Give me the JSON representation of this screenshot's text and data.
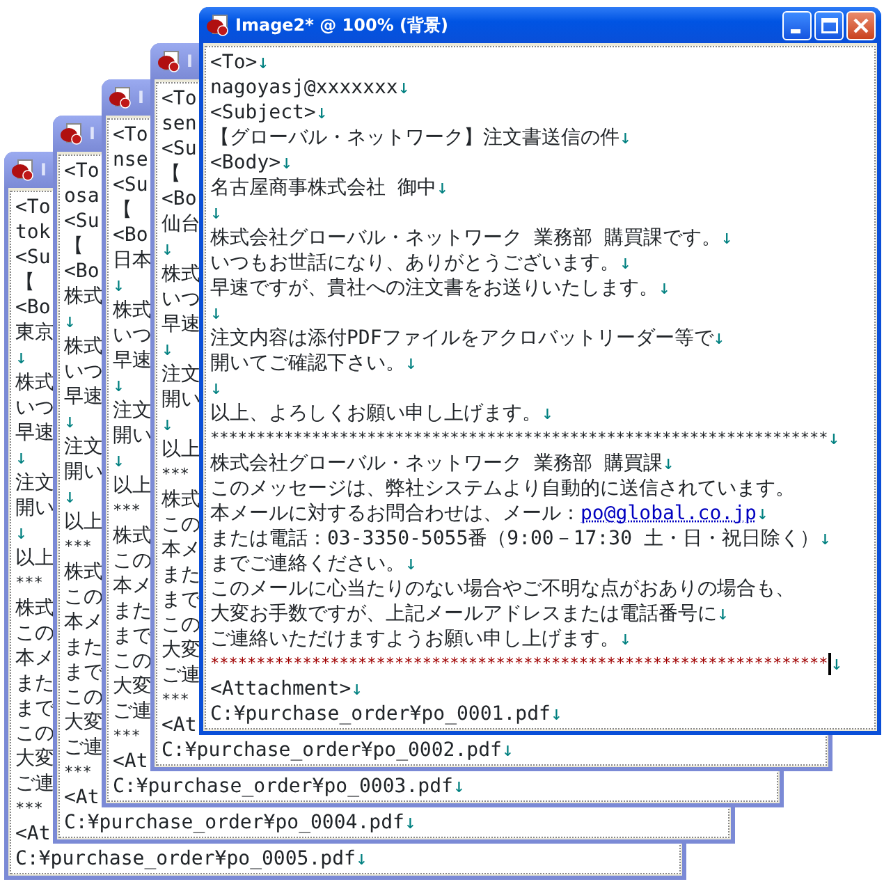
{
  "windows": [
    {
      "title": "I",
      "active": false,
      "lines": [
        {
          "text": "<To"
        },
        {
          "text": "tok"
        },
        {
          "text": "<Su"
        },
        {
          "text": "【"
        },
        {
          "text": "<Bo"
        },
        {
          "text": "東京"
        },
        {
          "eol": "↓"
        },
        {
          "text": "株式"
        },
        {
          "text": "いつ"
        },
        {
          "text": "早速"
        },
        {
          "eol": "↓"
        },
        {
          "text": "注文"
        },
        {
          "text": "開い"
        },
        {
          "eol": "↓"
        },
        {
          "text": "以上"
        },
        {
          "text": "***",
          "kind": "rule"
        },
        {
          "text": "株式"
        },
        {
          "text": "この"
        },
        {
          "text": "本メ"
        },
        {
          "text": "また"
        },
        {
          "text": "まで"
        },
        {
          "text": "この"
        },
        {
          "text": "大変"
        },
        {
          "text": "ご連"
        },
        {
          "text": "***",
          "kind": "rule"
        },
        {
          "text": "<At"
        },
        {
          "text": "C:¥purchase_order¥po_0005.pdf",
          "eol": "↓"
        }
      ]
    },
    {
      "title": "I",
      "active": false,
      "lines": [
        {
          "text": "<To"
        },
        {
          "text": "osa"
        },
        {
          "text": "<Su"
        },
        {
          "text": "【"
        },
        {
          "text": "<Bo"
        },
        {
          "text": "株式"
        },
        {
          "eol": "↓"
        },
        {
          "text": "株式"
        },
        {
          "text": "いつ"
        },
        {
          "text": "早速"
        },
        {
          "eol": "↓"
        },
        {
          "text": "注文"
        },
        {
          "text": "開い"
        },
        {
          "eol": "↓"
        },
        {
          "text": "以上"
        },
        {
          "text": "***",
          "kind": "rule"
        },
        {
          "text": "株式"
        },
        {
          "text": "この"
        },
        {
          "text": "本メ"
        },
        {
          "text": "また"
        },
        {
          "text": "まで"
        },
        {
          "text": "この"
        },
        {
          "text": "大変"
        },
        {
          "text": "ご連"
        },
        {
          "text": "***",
          "kind": "rule"
        },
        {
          "text": "<At"
        },
        {
          "text": "C:¥purchase_order¥po_0004.pdf",
          "eol": "↓"
        }
      ]
    },
    {
      "title": "I",
      "active": false,
      "lines": [
        {
          "text": "<To"
        },
        {
          "text": "nse"
        },
        {
          "text": "<Su"
        },
        {
          "text": "【"
        },
        {
          "text": "<Bo"
        },
        {
          "text": "日本"
        },
        {
          "eol": "↓"
        },
        {
          "text": "株式"
        },
        {
          "text": "いつ"
        },
        {
          "text": "早速"
        },
        {
          "eol": "↓"
        },
        {
          "text": "注文"
        },
        {
          "text": "開い"
        },
        {
          "eol": "↓"
        },
        {
          "text": "以上"
        },
        {
          "text": "***",
          "kind": "rule"
        },
        {
          "text": "株式"
        },
        {
          "text": "この"
        },
        {
          "text": "本メ"
        },
        {
          "text": "また"
        },
        {
          "text": "まで"
        },
        {
          "text": "この"
        },
        {
          "text": "大変"
        },
        {
          "text": "ご連"
        },
        {
          "text": "***",
          "kind": "rule"
        },
        {
          "text": "<At"
        },
        {
          "text": "C:¥purchase_order¥po_0003.pdf",
          "eol": "↓"
        }
      ]
    },
    {
      "title": "I",
      "active": false,
      "lines": [
        {
          "text": "<To"
        },
        {
          "text": "sen"
        },
        {
          "text": "<Su"
        },
        {
          "text": "【"
        },
        {
          "text": "<Bo"
        },
        {
          "text": "仙台"
        },
        {
          "eol": "↓"
        },
        {
          "text": "株式"
        },
        {
          "text": "いつ"
        },
        {
          "text": "早速"
        },
        {
          "eol": "↓"
        },
        {
          "text": "注文"
        },
        {
          "text": "開い"
        },
        {
          "eol": "↓"
        },
        {
          "text": "以上"
        },
        {
          "text": "***",
          "kind": "rule"
        },
        {
          "text": "株式"
        },
        {
          "text": "この"
        },
        {
          "text": "本メ"
        },
        {
          "text": "また"
        },
        {
          "text": "まで"
        },
        {
          "text": "この"
        },
        {
          "text": "大変"
        },
        {
          "text": "ご連"
        },
        {
          "text": "***",
          "kind": "rule"
        },
        {
          "text": "<At"
        },
        {
          "text": "C:¥purchase_order¥po_0002.pdf",
          "eol": "↓"
        }
      ]
    },
    {
      "title": "Image2* @ 100% (背景)",
      "active": true,
      "lines": [
        {
          "text": "<To>",
          "eol": "↓"
        },
        {
          "text": "nagoyasj@xxxxxxx",
          "eol": "↓"
        },
        {
          "text": "<Subject>",
          "eol": "↓"
        },
        {
          "text": " 【グローバル・ネットワーク】注文書送信の件",
          "eol": "↓"
        },
        {
          "text": "<Body>",
          "eol": "↓"
        },
        {
          "text": "名古屋商事株式会社 御中",
          "eol": "↓"
        },
        {
          "eol": "↓"
        },
        {
          "text": "株式会社グローバル・ネットワーク 業務部 購買課です。",
          "eol": "↓"
        },
        {
          "text": "いつもお世話になり、ありがとうございます。",
          "eol": "↓"
        },
        {
          "text": "早速ですが、貴社への注文書をお送りいたします。",
          "eol": "↓"
        },
        {
          "eol": "↓"
        },
        {
          "text": "注文内容は添付PDFファイルをアクロバットリーダー等で",
          "eol": "↓"
        },
        {
          "text": "開いてご確認下さい。",
          "eol": "↓"
        },
        {
          "eol": "↓"
        },
        {
          "text": "以上、よろしくお願い申し上げます。",
          "eol": "↓"
        },
        {
          "text": "*******************************************************************",
          "kind": "rule",
          "eol": "↓"
        },
        {
          "text": "株式会社グローバル・ネットワーク 業務部 購買課",
          "eol": "↓"
        },
        {
          "text": "このメッセージは、弊社システムより自動的に送信されています。"
        },
        {
          "text": "本メールに対するお問合わせは、メール：",
          "link": "po@global.co.jp",
          "eol": "↓"
        },
        {
          "text": "または電話：03-3350-5055番（9:00－17:30 土・日・祝日除く）",
          "eol": "↓"
        },
        {
          "text": "までご連絡ください。",
          "eol": "↓"
        },
        {
          "text": "このメールに心当たりのない場合やご不明な点がおありの場合も、"
        },
        {
          "text": "大変お手数ですが、上記メールアドレスまたは電話番号に",
          "eol": "↓"
        },
        {
          "text": "ご連絡いただけますようお願い申し上げます。",
          "eol": "↓"
        },
        {
          "text": "*******************************************************************",
          "kind": "rule",
          "color": "#a00000",
          "cursor": true,
          "eol": "↓"
        },
        {
          "text": "<Attachment>",
          "eol": "↓"
        },
        {
          "text": "C:¥purchase_order¥po_0001.pdf",
          "eol": "↓"
        }
      ]
    }
  ]
}
